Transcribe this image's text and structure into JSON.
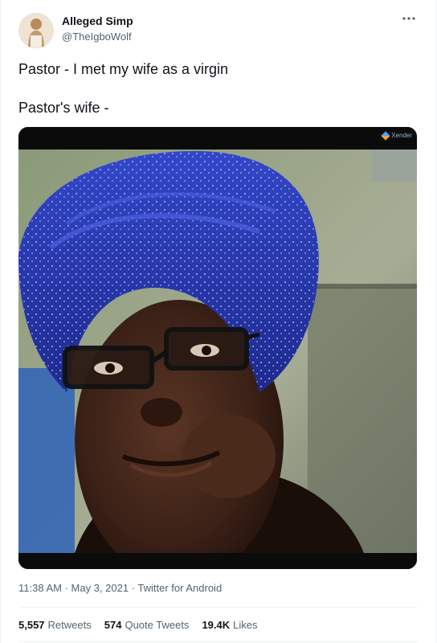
{
  "author": {
    "name": "Alleged Simp",
    "handle": "@TheIgboWolf"
  },
  "more_icon": "more-horizontal-icon",
  "tweet_text": {
    "line1": "Pastor - I met my wife as a virgin",
    "line2": "Pastor's wife -"
  },
  "media": {
    "watermark": "Xender"
  },
  "meta": {
    "time": "11:38 AM",
    "sep1": " · ",
    "date": "May 3, 2021",
    "sep2": " · ",
    "source": "Twitter for Android"
  },
  "stats": {
    "retweets": {
      "count": "5,557",
      "label": "Retweets"
    },
    "quotes": {
      "count": "574",
      "label": "Quote Tweets"
    },
    "likes": {
      "count": "19.4K",
      "label": "Likes"
    }
  },
  "colors": {
    "text": "#0f1419",
    "secondary": "#536471",
    "divider": "#eff3f4",
    "headwrap": "#2a3bb8"
  }
}
